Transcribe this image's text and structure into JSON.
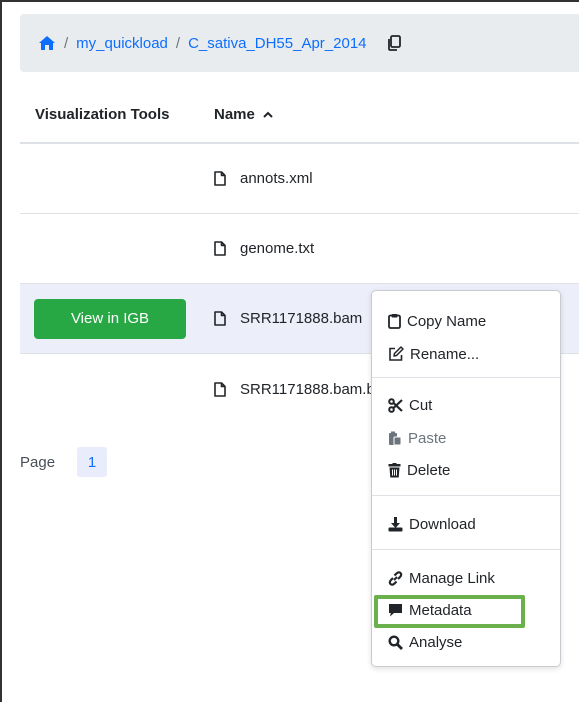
{
  "breadcrumb": {
    "separator": "/",
    "items": [
      "my_quickload",
      "C_sativa_DH55_Apr_2014"
    ]
  },
  "table": {
    "headers": {
      "tools": "Visualization Tools",
      "name": "Name"
    },
    "rows": [
      {
        "name": "annots.xml",
        "action": ""
      },
      {
        "name": "genome.txt",
        "action": ""
      },
      {
        "name": "SRR1171888.bam",
        "action": "View in IGB"
      },
      {
        "name": "SRR1171888.bam.b",
        "action": ""
      }
    ]
  },
  "pager": {
    "label": "Page",
    "current": "1"
  },
  "context_menu": {
    "items": [
      {
        "label": "Copy Name",
        "icon": "clipboard-icon"
      },
      {
        "label": "Rename...",
        "icon": "edit-icon"
      },
      {
        "label": "Cut",
        "icon": "scissors-icon"
      },
      {
        "label": "Paste",
        "icon": "paste-icon",
        "disabled": true
      },
      {
        "label": "Delete",
        "icon": "trash-icon"
      },
      {
        "label": "Download",
        "icon": "download-icon"
      },
      {
        "label": "Manage Link",
        "icon": "link-icon"
      },
      {
        "label": "Metadata",
        "icon": "comment-icon"
      },
      {
        "label": "Analyse",
        "icon": "magnifier-icon"
      }
    ]
  },
  "colors": {
    "link": "#0d6efd",
    "igb_button": "#28a745",
    "highlight": "#6ab04c",
    "selected_row": "#eceefa"
  }
}
